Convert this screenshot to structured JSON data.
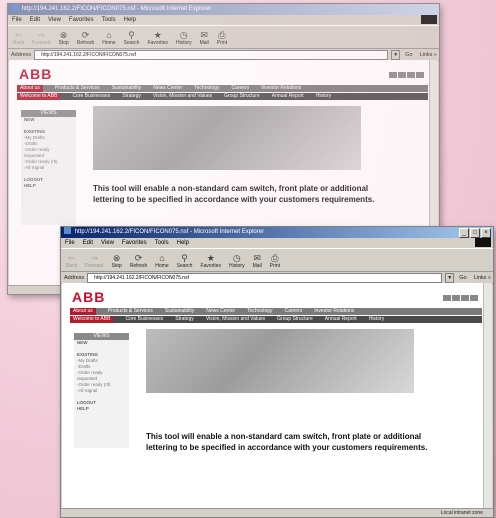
{
  "titlebar": {
    "title": "http://194.241.162.2/FICON/FICON075.nsf - Microsoft Internet Explorer",
    "buttons": [
      "_",
      "□",
      "×"
    ]
  },
  "menu": [
    "File",
    "Edit",
    "View",
    "Favorites",
    "Tools",
    "Help"
  ],
  "toolbar": [
    {
      "label": "Back",
      "icon": "back-arrow-icon",
      "glyph": "⇐",
      "disabled": true
    },
    {
      "label": "Forward",
      "icon": "forward-arrow-icon",
      "glyph": "⇒",
      "disabled": true
    },
    {
      "label": "Stop",
      "icon": "stop-icon",
      "glyph": "⊗",
      "disabled": false
    },
    {
      "label": "Refresh",
      "icon": "refresh-icon",
      "glyph": "⟳",
      "disabled": false
    },
    {
      "label": "Home",
      "icon": "home-icon",
      "glyph": "⌂",
      "disabled": false
    },
    {
      "label": "Search",
      "icon": "search-icon",
      "glyph": "⚲",
      "disabled": false
    },
    {
      "label": "Favorites",
      "icon": "favorites-icon",
      "glyph": "★",
      "disabled": false
    },
    {
      "label": "History",
      "icon": "history-icon",
      "glyph": "◷",
      "disabled": false
    },
    {
      "label": "Mail",
      "icon": "mail-icon",
      "glyph": "✉",
      "disabled": false
    },
    {
      "label": "Print",
      "icon": "print-icon",
      "glyph": "⎙",
      "disabled": false
    }
  ],
  "address": {
    "label": "Address",
    "url": "http://194.241.162.2/FICON/FICON075.nsf",
    "go": "Go",
    "links": "Links »"
  },
  "site": {
    "logo": "ABB",
    "nav_primary": [
      "About us",
      "Products & Services",
      "Sustainability",
      "News Center",
      "Technology",
      "Careers",
      "Investor Relations"
    ],
    "nav_secondary": [
      "Welcome to ABB",
      "Core Businesses",
      "Strategy",
      "Vision, Mission and Values",
      "Group Structure",
      "Annual Report",
      "History"
    ],
    "views_title": "VIEWS",
    "views_items": [
      "NEW",
      "EXISTING",
      "-My Drafts",
      "-Drafts",
      "-Order ready",
      "requested",
      "-Order ready (rtl)",
      "-All Signal",
      "LOGOUT",
      "HELP"
    ],
    "description": "This tool will enable a non-standard cam switch, front plate or additional lettering to be specified in accordance with your customers requirements."
  },
  "statusbar": {
    "zone": "Local intranet zone"
  },
  "colors": {
    "abb_red": "#c8102e",
    "titlebar_active": "#0a246a",
    "chrome": "#d4d0c8"
  }
}
